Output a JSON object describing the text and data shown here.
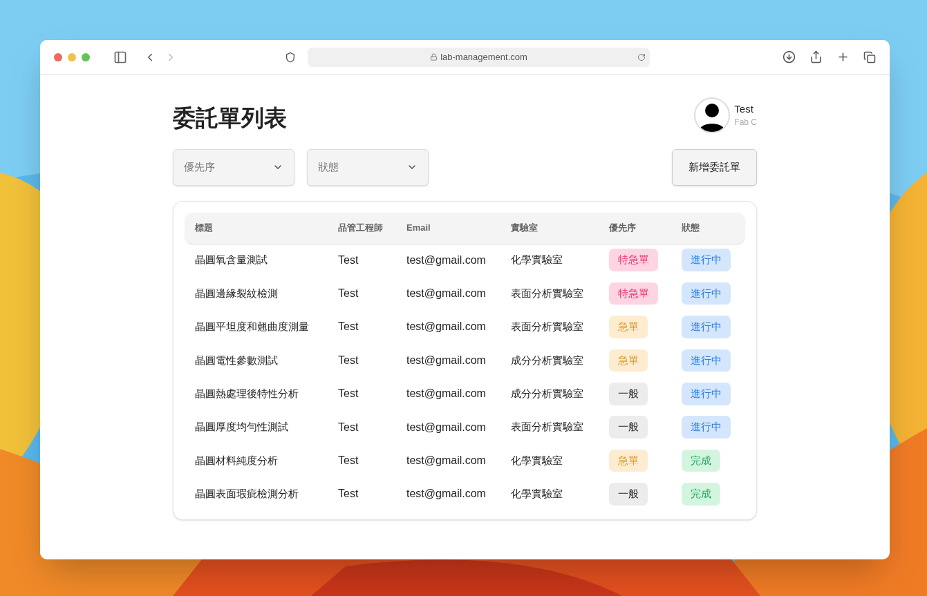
{
  "browser": {
    "url": "lab-management.com"
  },
  "page": {
    "title": "委託單列表",
    "user": {
      "name": "Test",
      "org": "Fab C"
    },
    "filters": [
      {
        "placeholder": "優先序"
      },
      {
        "placeholder": "狀態"
      }
    ],
    "new_button": "新增委託單"
  },
  "table": {
    "columns": [
      "標題",
      "品管工程師",
      "Email",
      "實驗室",
      "優先序",
      "狀態"
    ],
    "rows": [
      {
        "title": "晶圓氧含量測試",
        "engineer": "Test",
        "email": "test@gmail.com",
        "lab": "化學實驗室",
        "priority": {
          "label": "特急單",
          "kind": "critical"
        },
        "status": {
          "label": "進行中",
          "kind": "in_progress"
        }
      },
      {
        "title": "晶圓邊緣裂紋檢測",
        "engineer": "Test",
        "email": "test@gmail.com",
        "lab": "表面分析實驗室",
        "priority": {
          "label": "特急單",
          "kind": "critical"
        },
        "status": {
          "label": "進行中",
          "kind": "in_progress"
        }
      },
      {
        "title": "晶圓平坦度和翹曲度測量",
        "engineer": "Test",
        "email": "test@gmail.com",
        "lab": "表面分析實驗室",
        "priority": {
          "label": "急單",
          "kind": "urgent"
        },
        "status": {
          "label": "進行中",
          "kind": "in_progress"
        }
      },
      {
        "title": "晶圓電性參數測試",
        "engineer": "Test",
        "email": "test@gmail.com",
        "lab": "成分分析實驗室",
        "priority": {
          "label": "急單",
          "kind": "urgent"
        },
        "status": {
          "label": "進行中",
          "kind": "in_progress"
        }
      },
      {
        "title": "晶圓熱處理後特性分析",
        "engineer": "Test",
        "email": "test@gmail.com",
        "lab": "成分分析實驗室",
        "priority": {
          "label": "一般",
          "kind": "normal"
        },
        "status": {
          "label": "進行中",
          "kind": "in_progress"
        }
      },
      {
        "title": "晶圓厚度均勻性測試",
        "engineer": "Test",
        "email": "test@gmail.com",
        "lab": "表面分析實驗室",
        "priority": {
          "label": "一般",
          "kind": "normal"
        },
        "status": {
          "label": "進行中",
          "kind": "in_progress"
        }
      },
      {
        "title": "晶圓材料純度分析",
        "engineer": "Test",
        "email": "test@gmail.com",
        "lab": "化學實驗室",
        "priority": {
          "label": "急單",
          "kind": "urgent"
        },
        "status": {
          "label": "完成",
          "kind": "done"
        }
      },
      {
        "title": "晶圓表面瑕疵檢測分析",
        "engineer": "Test",
        "email": "test@gmail.com",
        "lab": "化學實驗室",
        "priority": {
          "label": "一般",
          "kind": "normal"
        },
        "status": {
          "label": "完成",
          "kind": "done"
        }
      }
    ]
  }
}
